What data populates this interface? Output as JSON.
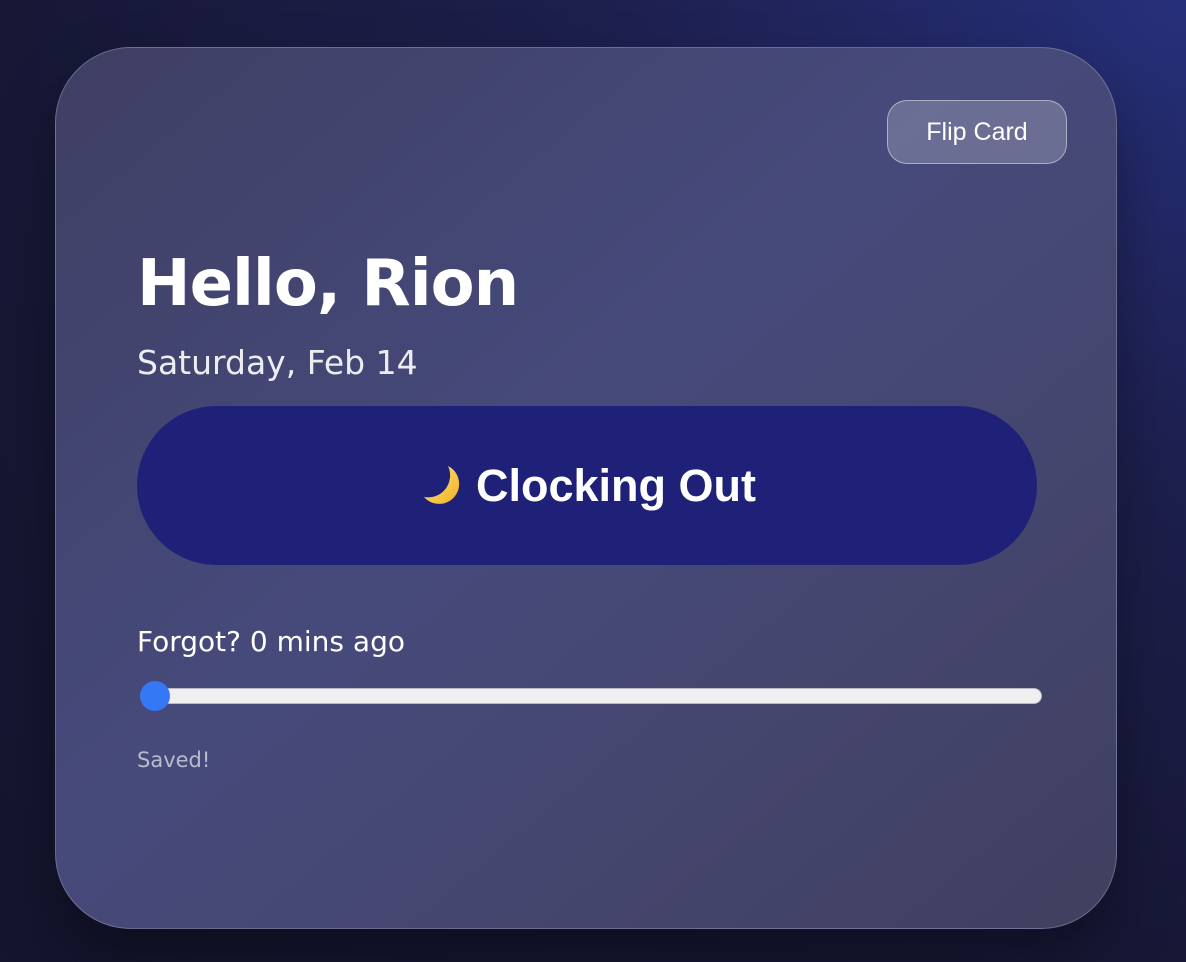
{
  "card": {
    "flip_button_label": "Flip Card",
    "greeting": "Hello, Rion",
    "date": "Saturday, Feb 14"
  },
  "clock_button": {
    "icon": "moon-icon",
    "label": "Clocking Out",
    "color": "#1e2177"
  },
  "forgot": {
    "label": "Forgot? 0 mins ago",
    "slider_value": 0,
    "slider_min": 0,
    "slider_max": 100,
    "accent_color": "#3478f6"
  },
  "status": {
    "text": "Saved!"
  }
}
